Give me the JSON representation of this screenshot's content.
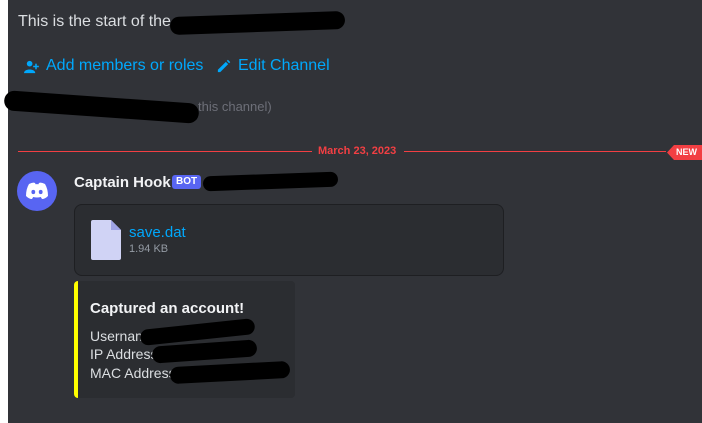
{
  "channel": {
    "start_text": "This is the start of the",
    "tail_text": "this channel)"
  },
  "actions": {
    "add_members": "Add members or roles",
    "edit_channel": "Edit Channel"
  },
  "divider": {
    "date": "March 23, 2023",
    "new_badge": "NEW"
  },
  "message": {
    "username": "Captain Hook",
    "bot_tag": "BOT",
    "attachment": {
      "file_name": "save.dat",
      "file_size": "1.94 KB"
    },
    "embed": {
      "title": "Captured an account!",
      "lines": [
        "Usernam",
        "IP Address",
        "MAC Address:"
      ],
      "accent_color": "#ffff00"
    }
  },
  "colors": {
    "background": "#313338",
    "link": "#00a8fc",
    "divider_red": "#f23f43",
    "blurple": "#5865f2"
  }
}
